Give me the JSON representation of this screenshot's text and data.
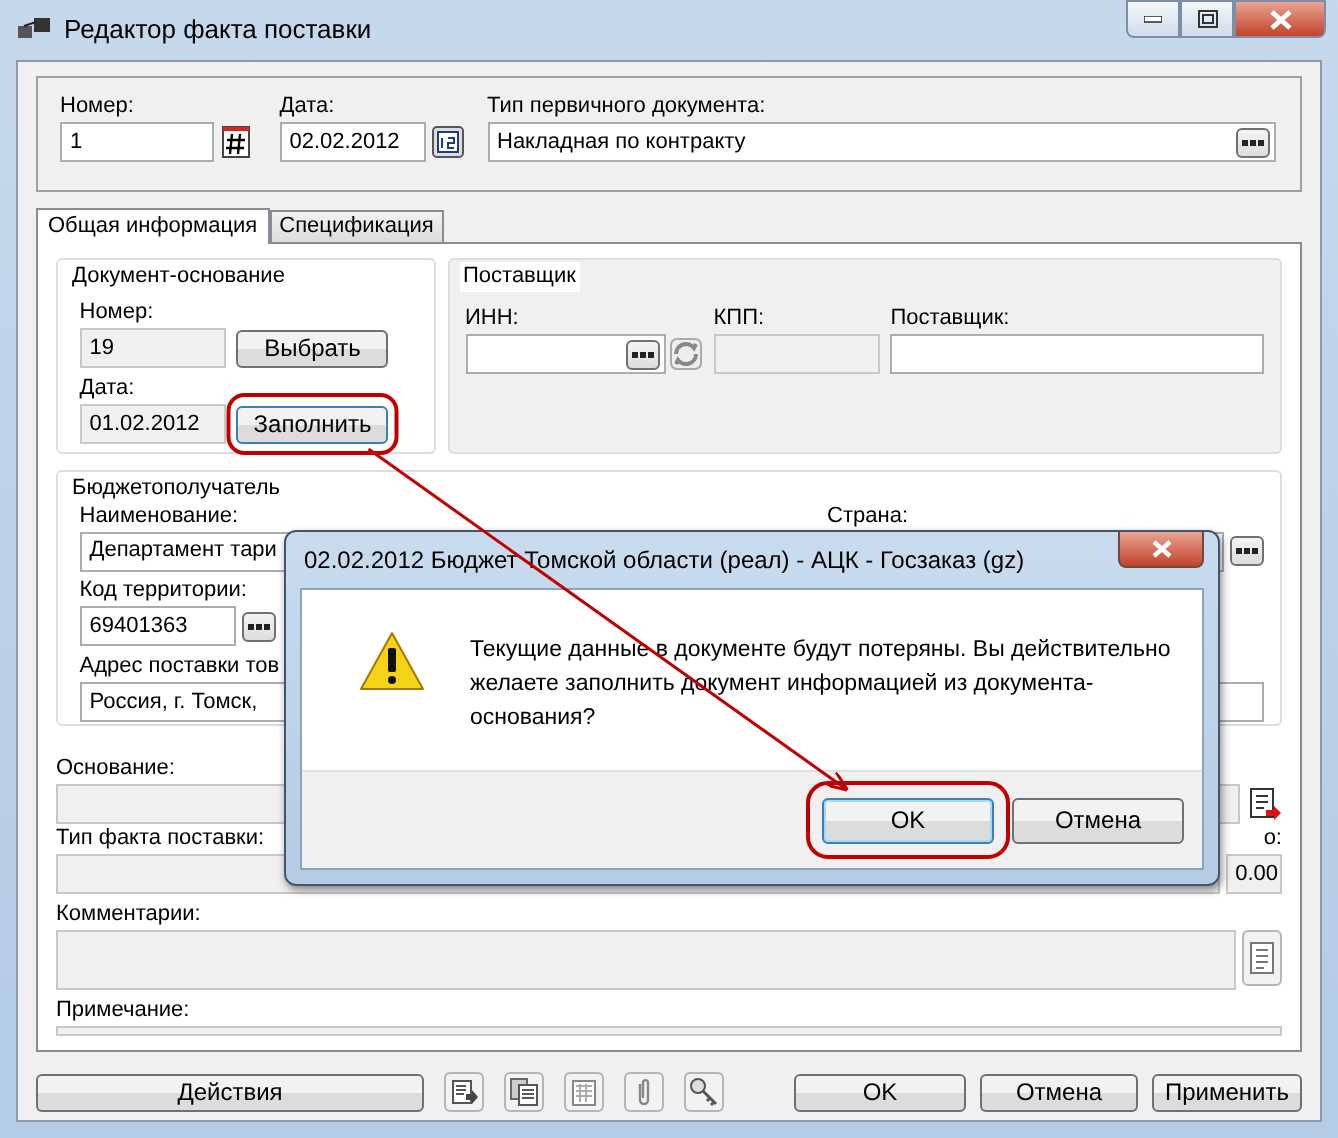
{
  "window": {
    "title": "Редактор факта поставки"
  },
  "header": {
    "number": {
      "label": "Номер:",
      "value": "1"
    },
    "date": {
      "label": "Дата:",
      "value": "02.02.2012"
    },
    "doc_type": {
      "label": "Тип первичного документа:",
      "value": "Накладная по контракту"
    }
  },
  "tabs": [
    {
      "label": "Общая информация",
      "selected": true
    },
    {
      "label": "Спецификация",
      "selected": false
    }
  ],
  "base_document": {
    "title": "Документ-основание",
    "number_label": "Номер:",
    "number": "19",
    "select_button": "Выбрать",
    "date_label": "Дата:",
    "date": "01.02.2012",
    "fill_button": "Заполнить"
  },
  "supplier": {
    "title": "Поставщик",
    "inn_label": "ИНН:",
    "kpp_label": "КПП:",
    "name_label": "Поставщик:"
  },
  "recipient": {
    "title": "Бюджетополучатель",
    "name_label": "Наименование:",
    "name": "Департамент тари",
    "country_label": "Страна:",
    "territory_label": "Код территории:",
    "territory": "69401363",
    "address_label": "Адрес поставки тов",
    "address": "Россия, г. Томск,"
  },
  "basis": {
    "label": "Основание:"
  },
  "fact_type": {
    "label": "Тип факта поставки:",
    "sum_label": "о:",
    "sum": "0.00"
  },
  "comments": {
    "label": "Комментарии:"
  },
  "note": {
    "label": "Примечание:"
  },
  "footer": {
    "actions": "Действия",
    "buttons": [
      "OK",
      "Отмена",
      "Применить"
    ]
  },
  "dialog": {
    "title": "02.02.2012 Бюджет Томской области (реал) - АЦК - Госзаказ (gz)",
    "message": "Текущие данные в документе будут потеряны. Вы действительно желаете заполнить документ информацией из документа-основания?",
    "buttons": [
      {
        "label": "OK",
        "default": true
      },
      {
        "label": "Отмена",
        "default": false
      }
    ]
  }
}
